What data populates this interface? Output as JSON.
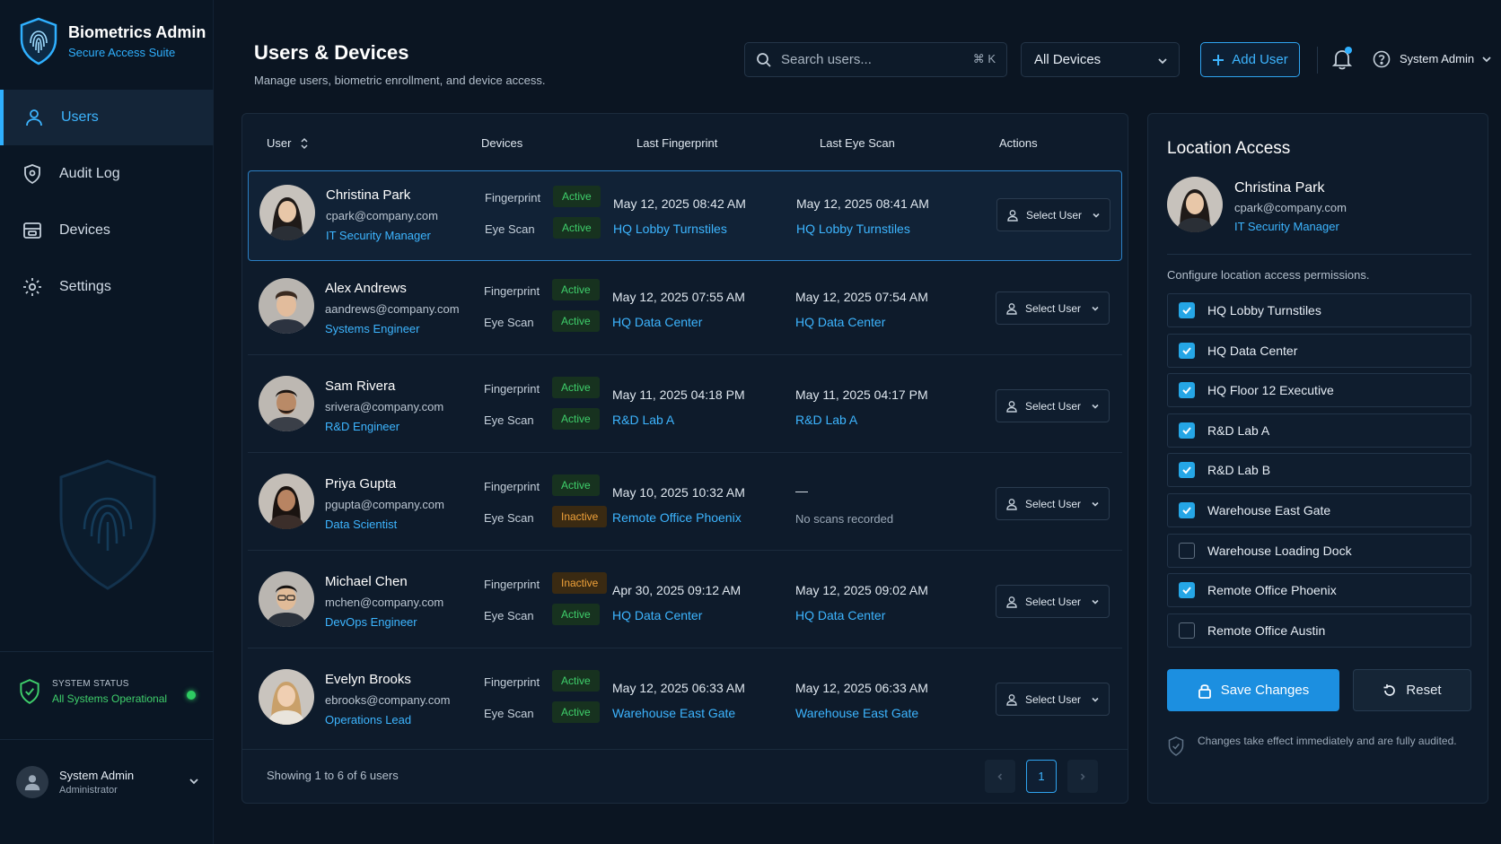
{
  "brand": {
    "title": "Biometrics Admin",
    "subtitle": "Secure Access Suite"
  },
  "sidebar": {
    "items": [
      {
        "label": "Users",
        "icon": "user-icon",
        "active": true
      },
      {
        "label": "Audit Log",
        "icon": "shield-icon",
        "active": false
      },
      {
        "label": "Devices",
        "icon": "device-icon",
        "active": false
      },
      {
        "label": "Settings",
        "icon": "gear-icon",
        "active": false
      }
    ],
    "status": {
      "label": "SYSTEM STATUS",
      "value": "All Systems Operational"
    },
    "user": {
      "name": "System Admin",
      "role": "Administrator"
    }
  },
  "header": {
    "title": "Users & Devices",
    "subtitle": "Manage users, biometric enrollment, and device access.",
    "search_placeholder": "Search users...",
    "search_shortcut": "⌘ K",
    "device_filter": "All Devices",
    "add_user": "Add User",
    "admin_name": "System Admin"
  },
  "table": {
    "columns": {
      "user": "User",
      "devices": "Devices",
      "last_fingerprint": "Last Fingerprint",
      "last_eye_scan": "Last Eye Scan",
      "actions": "Actions"
    },
    "device_labels": {
      "fingerprint": "Fingerprint",
      "eye_scan": "Eye Scan"
    },
    "action_label": "Select User",
    "rows": [
      {
        "name": "Christina Park",
        "email": "cpark@company.com",
        "role": "IT Security Manager",
        "fingerprint_status": "Active",
        "eye_status": "Active",
        "fp_time": "May 12, 2025 08:42 AM",
        "fp_location": "HQ Lobby Turnstiles",
        "eye_time": "May 12, 2025 08:41 AM",
        "eye_location": "HQ Lobby Turnstiles",
        "selected": true
      },
      {
        "name": "Alex Andrews",
        "email": "aandrews@company.com",
        "role": "Systems Engineer",
        "fingerprint_status": "Active",
        "eye_status": "Active",
        "fp_time": "May 12, 2025 07:55 AM",
        "fp_location": "HQ Data Center",
        "eye_time": "May 12, 2025 07:54 AM",
        "eye_location": "HQ Data Center"
      },
      {
        "name": "Sam Rivera",
        "email": "srivera@company.com",
        "role": "R&D Engineer",
        "fingerprint_status": "Active",
        "eye_status": "Active",
        "fp_time": "May 11, 2025 04:18 PM",
        "fp_location": "R&D Lab A",
        "eye_time": "May 11, 2025 04:17 PM",
        "eye_location": "R&D Lab A"
      },
      {
        "name": "Priya Gupta",
        "email": "pgupta@company.com",
        "role": "Data Scientist",
        "fingerprint_status": "Active",
        "eye_status": "Inactive",
        "fp_time": "May 10, 2025 10:32 AM",
        "fp_location": "Remote Office Phoenix",
        "eye_time": "—",
        "eye_location": "No scans recorded"
      },
      {
        "name": "Michael Chen",
        "email": "mchen@company.com",
        "role": "DevOps Engineer",
        "fingerprint_status": "Inactive",
        "eye_status": "Active",
        "fp_time": "Apr 30, 2025 09:12 AM",
        "fp_location": "HQ Data Center",
        "eye_time": "May 12, 2025 09:02 AM",
        "eye_location": "HQ Data Center"
      },
      {
        "name": "Evelyn Brooks",
        "email": "ebrooks@company.com",
        "role": "Operations Lead",
        "fingerprint_status": "Active",
        "eye_status": "Active",
        "fp_time": "May 12, 2025 06:33 AM",
        "fp_location": "Warehouse East Gate",
        "eye_time": "May 12, 2025 06:33 AM",
        "eye_location": "Warehouse East Gate"
      }
    ],
    "footer": "Showing 1 to 6 of 6 users",
    "page": "1"
  },
  "panel": {
    "title": "Location Access",
    "user": {
      "name": "Christina Park",
      "email": "cpark@company.com",
      "role": "IT Security Manager"
    },
    "description": "Configure location access permissions.",
    "locations": [
      {
        "label": "HQ Lobby Turnstiles",
        "checked": true
      },
      {
        "label": "HQ Data Center",
        "checked": true
      },
      {
        "label": "HQ Floor 12 Executive",
        "checked": true
      },
      {
        "label": "R&D Lab A",
        "checked": true
      },
      {
        "label": "R&D Lab B",
        "checked": true
      },
      {
        "label": "Warehouse East Gate",
        "checked": true
      },
      {
        "label": "Warehouse Loading Dock",
        "checked": false
      },
      {
        "label": "Remote Office Phoenix",
        "checked": true
      },
      {
        "label": "Remote Office Austin",
        "checked": false
      }
    ],
    "save_label": "Save Changes",
    "reset_label": "Reset",
    "note": "Changes take effect immediately and are fully audited."
  },
  "colors": {
    "accent": "#2fb0ff",
    "active": "#3fcf6b",
    "inactive": "#f0a23a",
    "background": "#0b1522"
  }
}
